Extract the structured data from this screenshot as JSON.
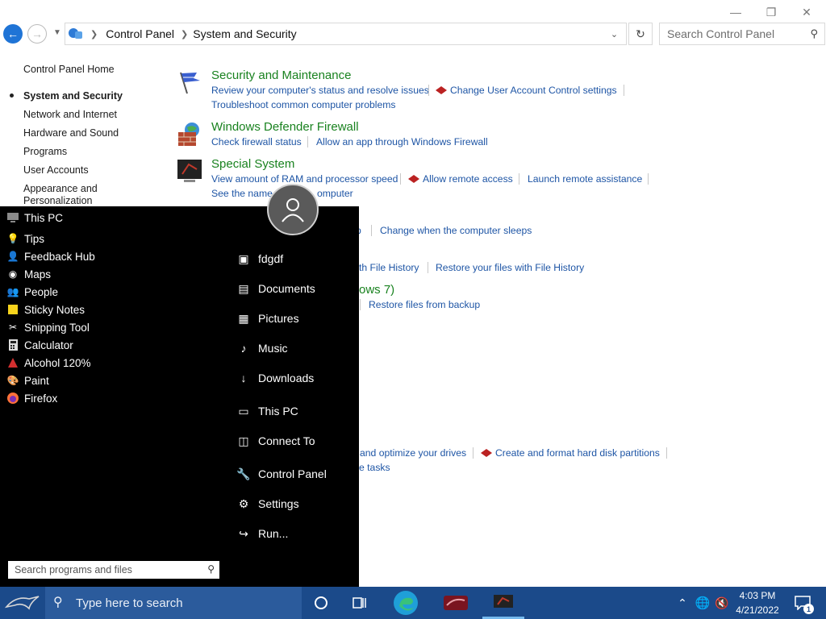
{
  "window": {
    "address": {
      "crumbs": [
        "Control Panel",
        "System and Security"
      ]
    },
    "search_placeholder": "Search Control Panel"
  },
  "left_nav": {
    "home": "Control Panel Home",
    "items": [
      "System and Security",
      "Network and Internet",
      "Hardware and Sound",
      "Programs",
      "User Accounts",
      "Appearance and",
      "Personalization"
    ]
  },
  "categories": {
    "security": {
      "title": "Security and Maintenance",
      "links": [
        "Review your computer's status and resolve issues",
        "Change User Account Control settings",
        "Troubleshoot common computer problems"
      ]
    },
    "firewall": {
      "title": "Windows Defender Firewall",
      "links": [
        "Check firewall status",
        "Allow an app through Windows Firewall"
      ]
    },
    "system": {
      "title": "Special System",
      "links": [
        "View amount of RAM and processor speed",
        "Allow remote access",
        "Launch remote assistance",
        "See the name",
        "omputer"
      ]
    },
    "partial": {
      "power_tail": "p",
      "power_sleep": "Change when the computer sleeps",
      "history_a": "th File History",
      "history_b": "Restore your files with File History",
      "backup_title": "ows 7)",
      "backup_link": "Restore files from backup",
      "drives_a": "and optimize your drives",
      "drives_b": "Create and format hard disk partitions",
      "tasks": "e tasks"
    }
  },
  "start_menu": {
    "apps": [
      "This PC",
      "Tips",
      "Feedback Hub",
      "Maps",
      "People",
      "Sticky Notes",
      "Snipping Tool",
      "Calculator",
      "Alcohol 120%",
      "Paint",
      "Firefox"
    ],
    "right": [
      "fdgdf",
      "Documents",
      "Pictures",
      "Music",
      "Downloads",
      "This PC",
      "Connect To",
      "Control Panel",
      "Settings",
      "Run..."
    ],
    "search_placeholder": "Search programs and files"
  },
  "taskbar": {
    "search_placeholder": "Type here to search",
    "time": "4:03 PM",
    "date": "4/21/2022",
    "notification_count": "1"
  },
  "colors": {
    "link": "#1e55a5",
    "category_title": "#19821f",
    "taskbar": "#1b4a8a"
  }
}
